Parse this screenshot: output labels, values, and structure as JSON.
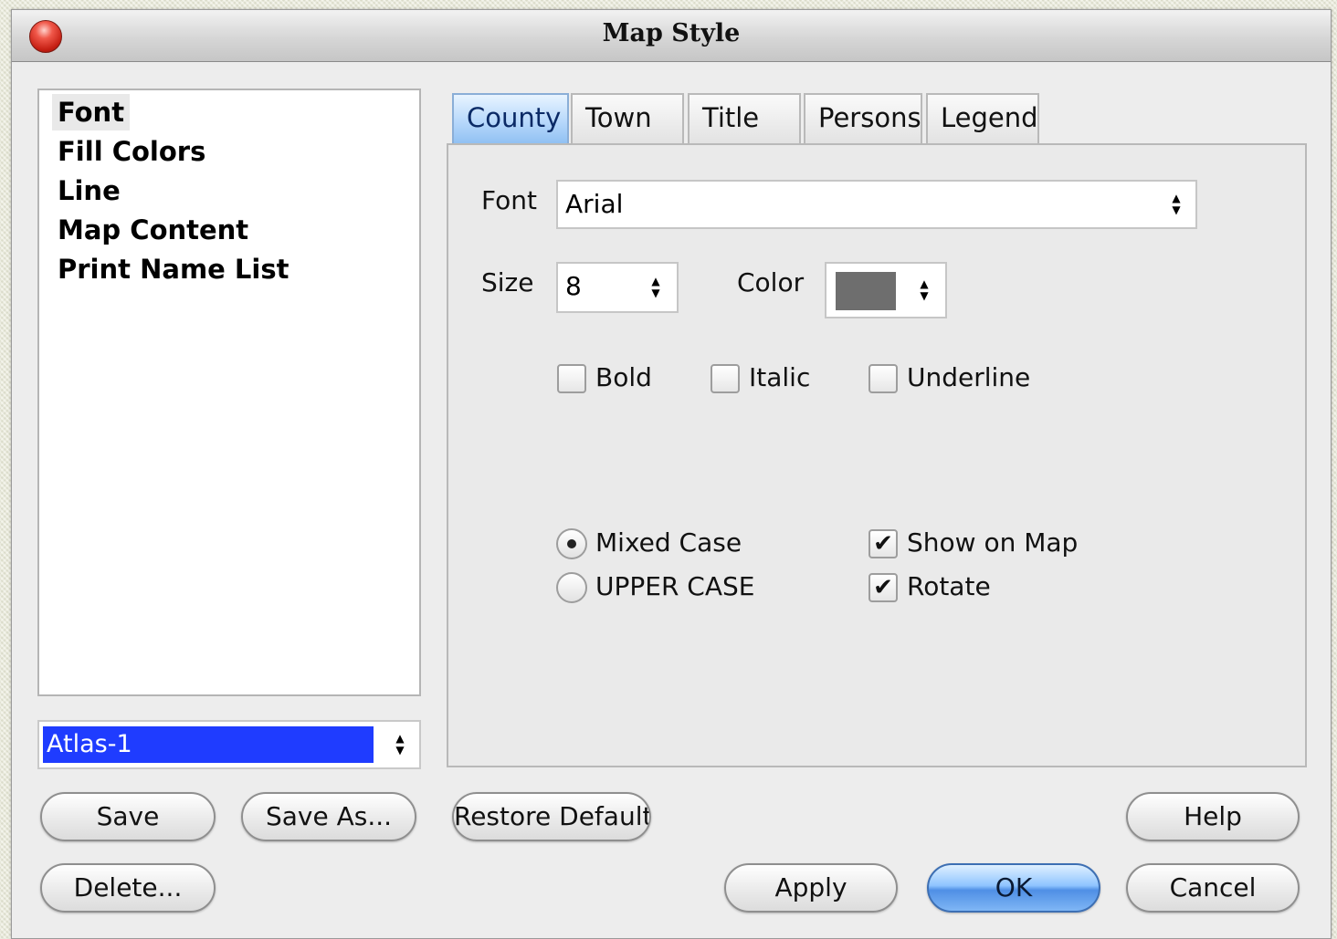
{
  "window": {
    "title": "Map Style"
  },
  "style_list": {
    "items": [
      {
        "label": "Font",
        "selected": true
      },
      {
        "label": "Fill Colors"
      },
      {
        "label": "Line"
      },
      {
        "label": "Map Content"
      },
      {
        "label": "Print Name List"
      }
    ]
  },
  "atlas_select": {
    "value": "Atlas-1"
  },
  "tabs": [
    {
      "label": "County",
      "active": true
    },
    {
      "label": "Town"
    },
    {
      "label": "Title"
    },
    {
      "label": "Persons"
    },
    {
      "label": "Legend"
    }
  ],
  "font_panel": {
    "font_label": "Font",
    "font_value": "Arial",
    "size_label": "Size",
    "size_value": "8",
    "color_label": "Color",
    "color_value": "#6e6e6e",
    "bold_label": "Bold",
    "bold_checked": false,
    "italic_label": "Italic",
    "italic_checked": false,
    "underline_label": "Underline",
    "underline_checked": false,
    "mixed_case_label": "Mixed Case",
    "mixed_case_selected": true,
    "upper_case_label": "UPPER CASE",
    "upper_case_selected": false,
    "show_on_map_label": "Show on Map",
    "show_on_map_checked": true,
    "rotate_label": "Rotate",
    "rotate_checked": true
  },
  "buttons": {
    "save": "Save",
    "save_as": "Save As...",
    "delete": "Delete...",
    "restore_defaults": "Restore Defaults",
    "help": "Help",
    "apply": "Apply",
    "ok": "OK",
    "cancel": "Cancel"
  },
  "colors": {
    "selection": "#1f3cff",
    "default_button": "#4f8fe5",
    "close_button": "#c51f13"
  }
}
